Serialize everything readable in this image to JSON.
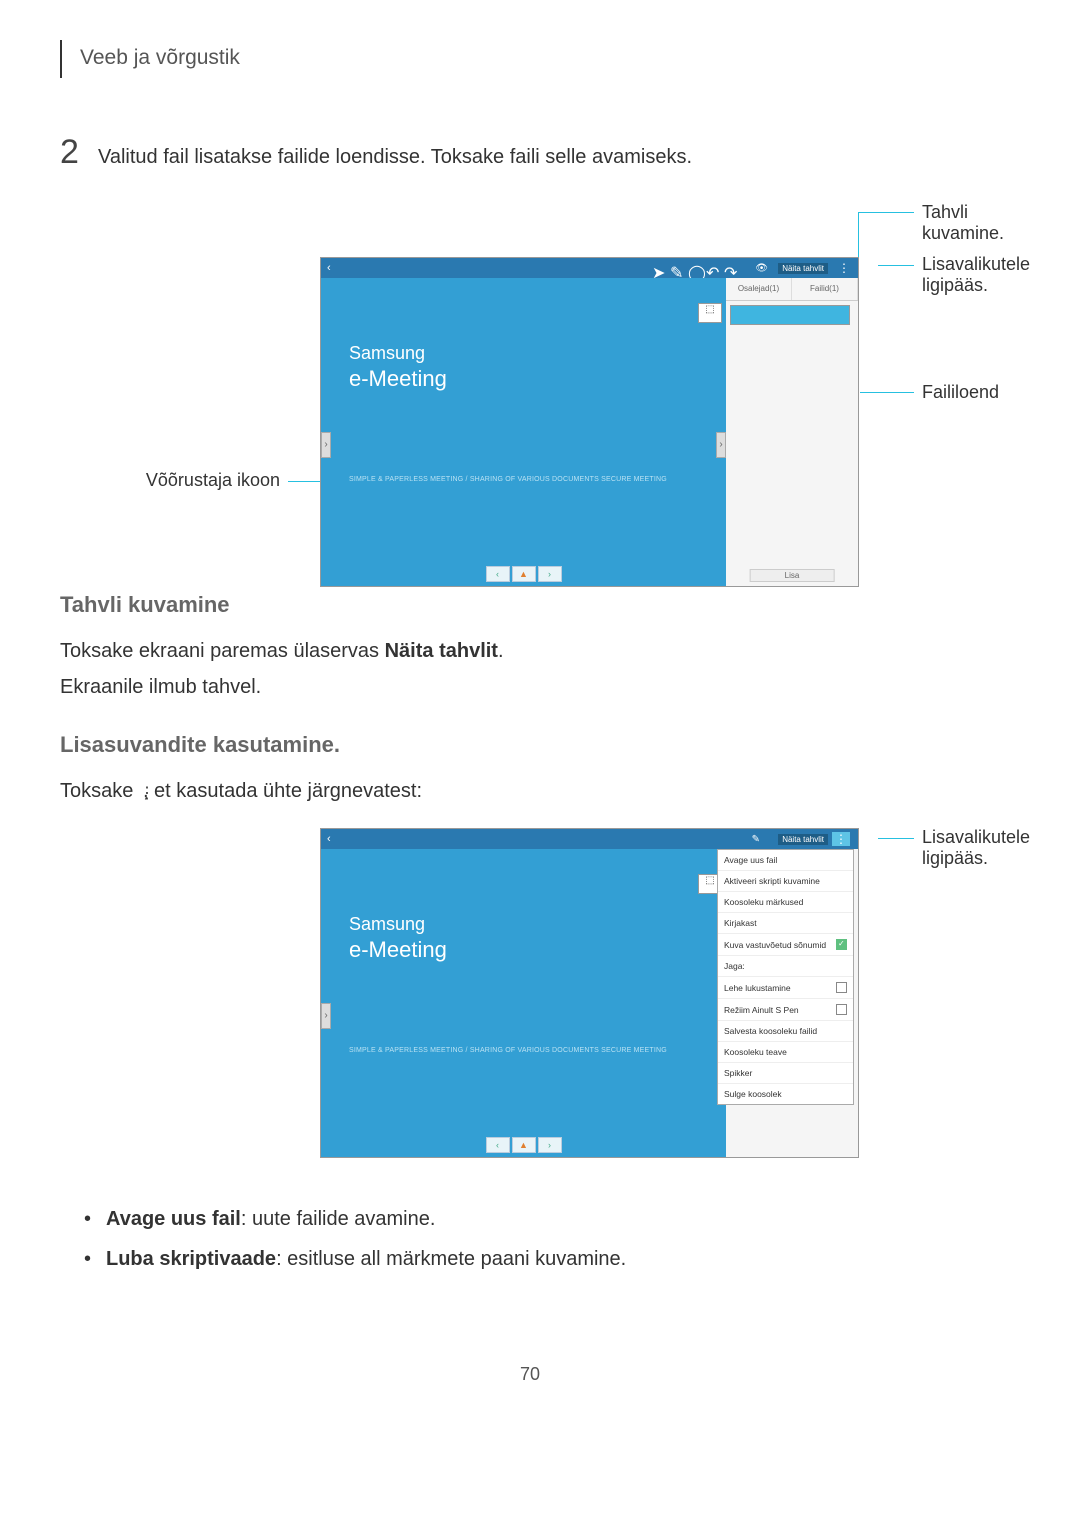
{
  "header": "Veeb ja võrgustik",
  "step": {
    "number": "2",
    "text": "Valitud fail lisatakse failide loendisse. Toksake faili selle avamiseks."
  },
  "diagram1": {
    "callout_top_right": "Tahvli kuvamine.",
    "callout_mid_right_l1": "Lisavalikutele",
    "callout_mid_right_l2": "ligipääs.",
    "callout_low_right": "Faililoend",
    "callout_left": "Võõrustaja ikoon",
    "ss": {
      "show_board": "Näita tahvlit",
      "logo1": "Samsung",
      "logo2": "e-Meeting",
      "tagline": "SIMPLE & PAPERLESS MEETING / SHARING OF VARIOUS DOCUMENTS SECURE MEETING",
      "tab1": "Osalejad(1)",
      "tab2": "Failid(1)",
      "lisa": "Lisa"
    }
  },
  "section1": {
    "heading": "Tahvli kuvamine",
    "line1_pre": "Toksake ekraani paremas ülaservas ",
    "line1_bold": "Näita tahvlit",
    "line1_post": ".",
    "line2": "Ekraanile ilmub tahvel."
  },
  "section2": {
    "heading": "Lisasuvandite kasutamine.",
    "line1_pre": "Toksake ",
    "line1_post": ", et kasutada ühte järgnevatest:"
  },
  "diagram2": {
    "callout_right_l1": "Lisavalikutele",
    "callout_right_l2": "ligipääs.",
    "ss": {
      "show_board": "Näita tahvlit",
      "logo1": "Samsung",
      "logo2": "e-Meeting",
      "tagline": "SIMPLE & PAPERLESS MEETING / SHARING OF VARIOUS DOCUMENTS SECURE MEETING",
      "menu": [
        "Avage uus fail",
        "Aktiveeri skripti kuvamine",
        "Koosoleku märkused",
        "Kirjakast",
        "Kuva vastuvõetud sõnumid",
        "Jaga:",
        "Lehe lukustamine",
        "Režiim Ainult S Pen",
        "Salvesta koosoleku failid",
        "Koosoleku teave",
        "Spikker",
        "Sulge koosolek"
      ]
    }
  },
  "bullets": [
    {
      "bold": "Avage uus fail",
      "rest": ": uute failide avamine."
    },
    {
      "bold": "Luba skriptivaade",
      "rest": ": esitluse all märkmete paani kuvamine."
    }
  ],
  "page_number": "70"
}
